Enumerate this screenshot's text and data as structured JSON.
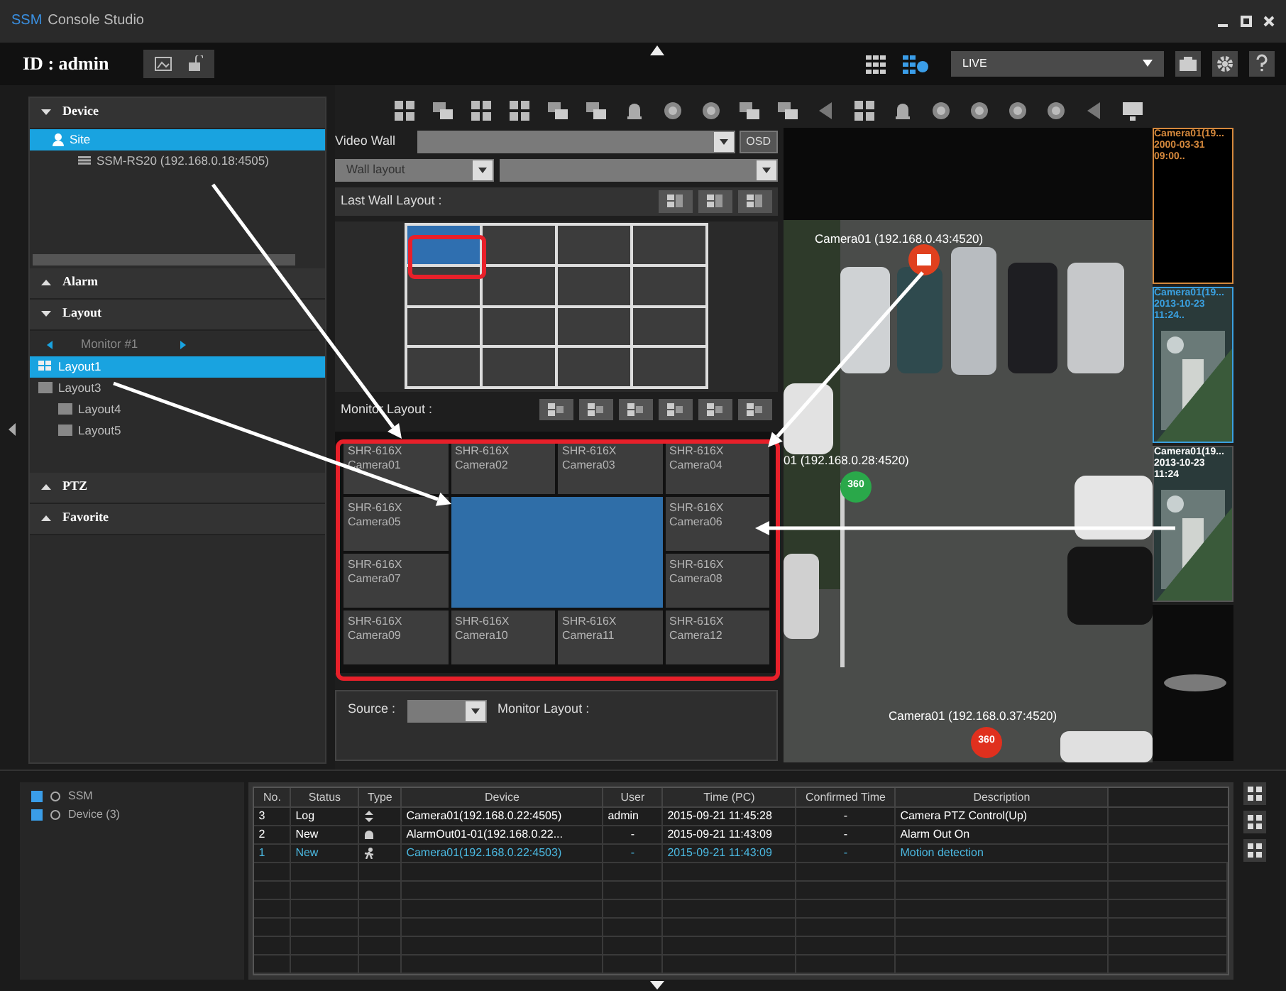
{
  "window": {
    "brand": "SSM",
    "title": "Console Studio",
    "user_label": "ID : admin"
  },
  "mode_select": {
    "value": "LIVE"
  },
  "device_panel": {
    "title": "Device",
    "expanded": true,
    "tree": [
      {
        "label": "Site",
        "selected": true,
        "children": [
          {
            "label": "SSM-RS20 (192.168.0.18:4505)",
            "selected": false
          }
        ]
      }
    ]
  },
  "alarm_panel": {
    "title": "Alarm",
    "expanded": false
  },
  "layout_panel": {
    "title": "Layout",
    "expanded": true,
    "monitor": "Monitor #1",
    "tree": [
      {
        "label": "Layout1",
        "selected": true
      },
      {
        "label": "Layout3",
        "selected": false,
        "children": [
          {
            "label": "Layout4",
            "selected": false
          },
          {
            "label": "Layout5",
            "selected": false
          }
        ]
      }
    ]
  },
  "ptz_panel": {
    "title": "PTZ",
    "expanded": false
  },
  "favorite_panel": {
    "title": "Favorite",
    "expanded": false
  },
  "video_wall": {
    "label": "Video Wall",
    "osd": "OSD",
    "wall_layout": "Wall layout",
    "last_wall_layout": "Last Wall Layout :",
    "cells": [
      {
        "selected": true
      },
      {
        "selected": false
      },
      {
        "selected": false
      },
      {
        "selected": false
      },
      {
        "selected": false
      },
      {
        "selected": false
      },
      {
        "selected": false
      },
      {
        "selected": false
      },
      {
        "selected": false
      },
      {
        "selected": false
      },
      {
        "selected": false
      },
      {
        "selected": false
      },
      {
        "selected": false
      },
      {
        "selected": false
      },
      {
        "selected": false
      },
      {
        "selected": false
      }
    ]
  },
  "monitor_layout": {
    "label": "Monitor Layout :",
    "cells": [
      {
        "kind": "single",
        "model": "SHR-616X",
        "camera": "Camera01",
        "selected": false
      },
      {
        "kind": "single",
        "model": "SHR-616X",
        "camera": "Camera02",
        "selected": false
      },
      {
        "kind": "single",
        "model": "SHR-616X",
        "camera": "Camera03",
        "selected": false
      },
      {
        "kind": "single",
        "model": "SHR-616X",
        "camera": "Camera04",
        "selected": false
      },
      {
        "kind": "single",
        "model": "SHR-616X",
        "camera": "Camera05",
        "selected": false
      },
      {
        "kind": "merged",
        "selected": true
      },
      {
        "kind": "single",
        "model": "SHR-616X",
        "camera": "Camera06",
        "selected": false
      },
      {
        "kind": "single",
        "model": "SHR-616X",
        "camera": "Camera07",
        "selected": false
      },
      {
        "kind": "single",
        "model": "SHR-616X",
        "camera": "Camera08",
        "selected": false
      },
      {
        "kind": "single",
        "model": "SHR-616X",
        "camera": "Camera09",
        "selected": false
      },
      {
        "kind": "single",
        "model": "SHR-616X",
        "camera": "Camera10",
        "selected": false
      },
      {
        "kind": "single",
        "model": "SHR-616X",
        "camera": "Camera11",
        "selected": false
      },
      {
        "kind": "single",
        "model": "SHR-616X",
        "camera": "Camera12",
        "selected": false
      }
    ]
  },
  "source": {
    "label": "Source :",
    "layout_label": "Monitor Layout :"
  },
  "camera_view": {
    "overlays": [
      {
        "text": "Camera01 (192.168.0.43:4520)",
        "kind": "camera",
        "color": "#e0401e"
      },
      {
        "text": "01 (192.168.0.28:4520)",
        "kind": "fisheye",
        "badge": "360",
        "color": "#2aa84a"
      },
      {
        "text": "Camera01 (192.168.0.37:4520)",
        "kind": "fisheye",
        "badge": "360",
        "color": "#e0301e"
      }
    ]
  },
  "thumbnails": [
    {
      "kind": "dark",
      "line1": "Camera01(19...",
      "line2": "2000-03-31 09:00..",
      "color": "#d4883c"
    },
    {
      "kind": "video",
      "line1": "Camera01(19...",
      "line2": "2013-10-23 11:24..",
      "color": "#3aa0e0"
    },
    {
      "kind": "video",
      "line1": "Camera01(19...",
      "line2": "2013-10-23 11:24",
      "color": "#555555"
    },
    {
      "kind": "logo"
    }
  ],
  "event_tree": [
    {
      "label": "SSM",
      "checked": true
    },
    {
      "label": "Device (3)",
      "checked": true
    }
  ],
  "events": {
    "columns": [
      "No.",
      "Status",
      "Type",
      "Device",
      "User",
      "Time (PC)",
      "Confirmed Time",
      "Description"
    ],
    "rows": [
      {
        "no": "3",
        "status": "Log",
        "kind": "ptz",
        "device": "Camera01(192.168.0.22:4505)",
        "user": "admin",
        "time": "2015-09-21 11:45:28",
        "confirmed": "-",
        "description": "Camera PTZ Control(Up)",
        "selected": false
      },
      {
        "no": "2",
        "status": "New",
        "kind": "alarm",
        "device": "AlarmOut01-01(192.168.0.22...",
        "user": "-",
        "time": "2015-09-21 11:43:09",
        "confirmed": "-",
        "description": "Alarm Out On",
        "selected": false
      },
      {
        "no": "1",
        "status": "New",
        "kind": "motion",
        "device": "Camera01(192.168.0.22:4503)",
        "user": "-",
        "time": "2015-09-21 11:43:09",
        "confirmed": "-",
        "description": "Motion detection",
        "selected": true
      }
    ]
  }
}
